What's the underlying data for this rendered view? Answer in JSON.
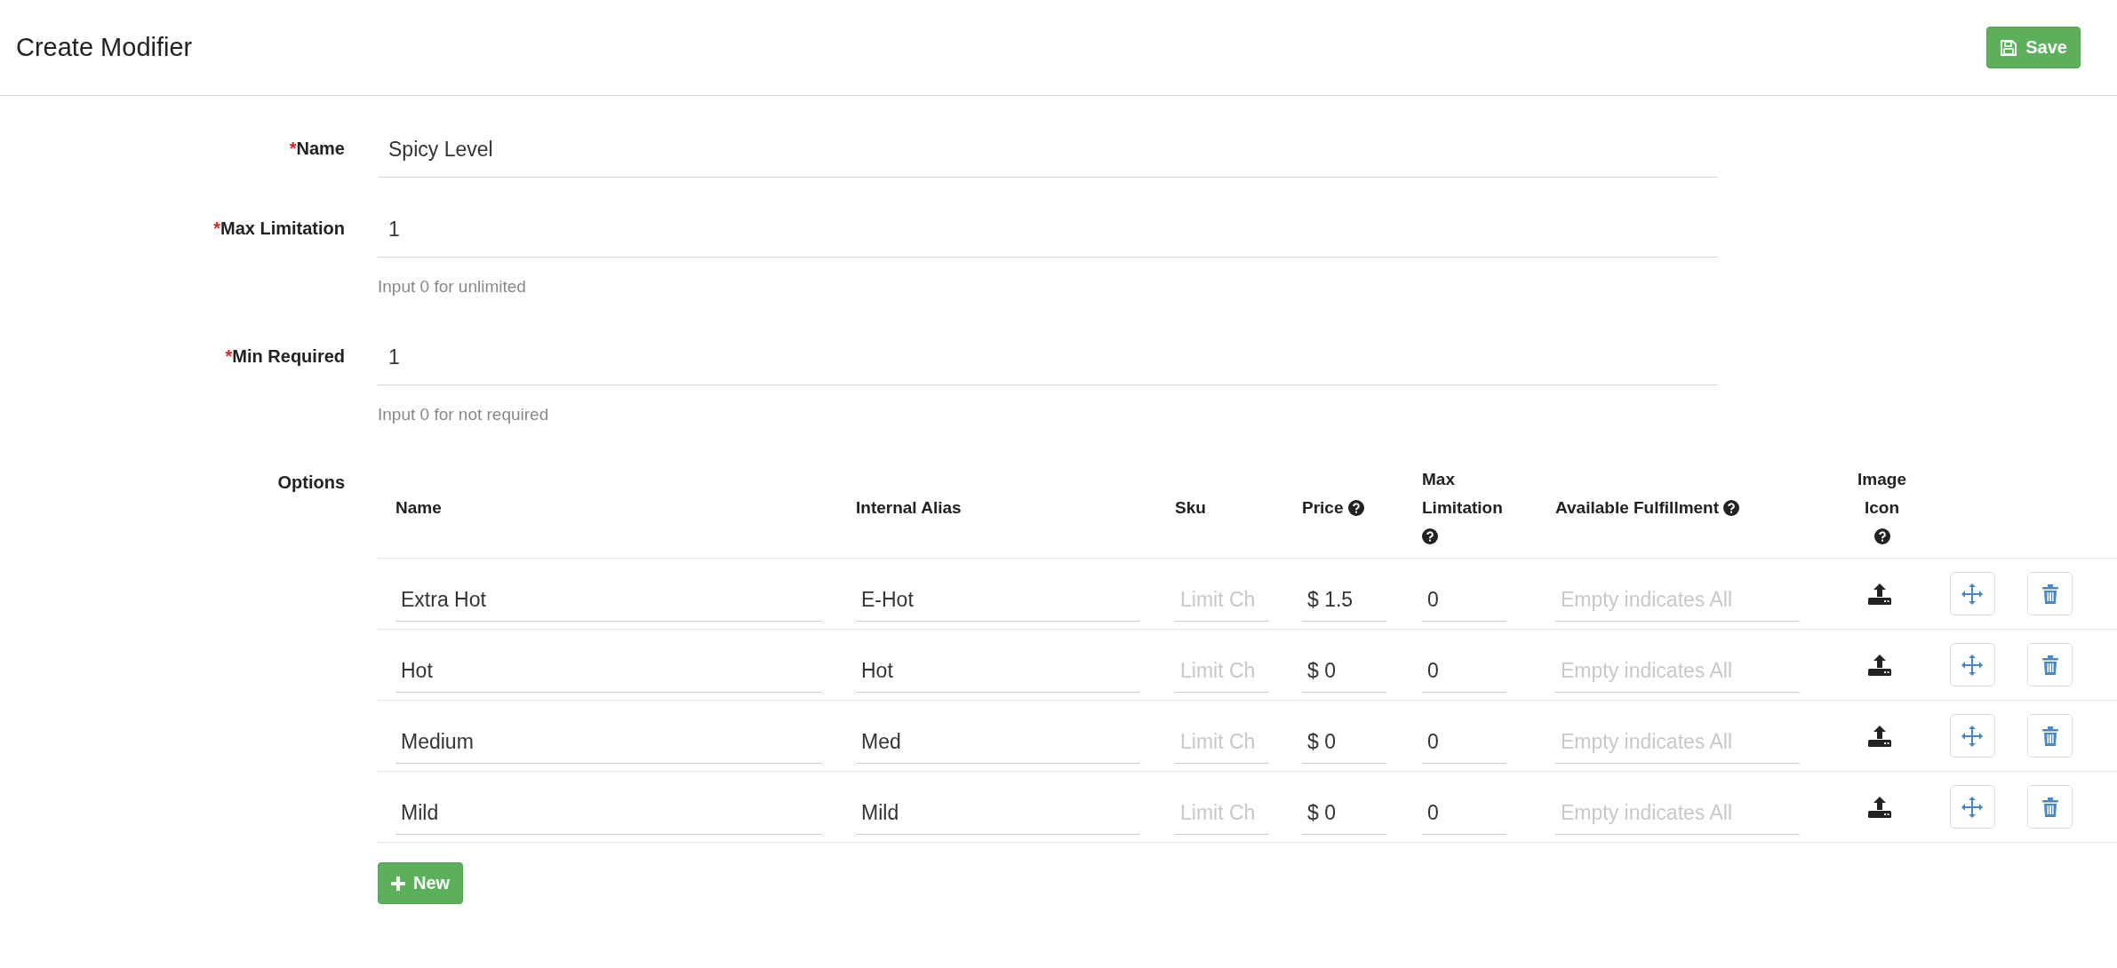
{
  "header": {
    "title": "Create Modifier",
    "save_button": "Save"
  },
  "fields": [
    {
      "required_mark": "*",
      "label": "Name",
      "value": "Spicy Level"
    },
    {
      "required_mark": "*",
      "label": "Max Limitation",
      "value": "1",
      "hint": "Input 0 for unlimited"
    },
    {
      "required_mark": "*",
      "label": "Min Required",
      "value": "1",
      "hint": "Input 0 for not required"
    }
  ],
  "options": {
    "label": "Options",
    "columns": [
      {
        "label": "Name",
        "help": false
      },
      {
        "label": "Internal Alias",
        "help": false
      },
      {
        "label": "Sku",
        "help": false
      },
      {
        "label": "Price",
        "help": true
      },
      {
        "label": "Max Limitation",
        "help": true
      },
      {
        "label": "Available Fulfillment",
        "help": true
      },
      {
        "label": "Image Icon",
        "help": true
      }
    ],
    "rows": [
      {
        "name": "Extra Hot",
        "alias": "E-Hot",
        "sku_placeholder": "Limit Ch",
        "price": "$ 1.5",
        "max_limitation": "0",
        "fulfillment_placeholder": "Empty indicates All"
      },
      {
        "name": "Hot",
        "alias": "Hot",
        "sku_placeholder": "Limit Ch",
        "price": "$ 0",
        "max_limitation": "0",
        "fulfillment_placeholder": "Empty indicates All"
      },
      {
        "name": "Medium",
        "alias": "Med",
        "sku_placeholder": "Limit Ch",
        "price": "$ 0",
        "max_limitation": "0",
        "fulfillment_placeholder": "Empty indicates All"
      },
      {
        "name": "Mild",
        "alias": "Mild",
        "sku_placeholder": "Limit Ch",
        "price": "$ 0",
        "max_limitation": "0",
        "fulfillment_placeholder": "Empty indicates All"
      }
    ],
    "new_button": "New"
  }
}
